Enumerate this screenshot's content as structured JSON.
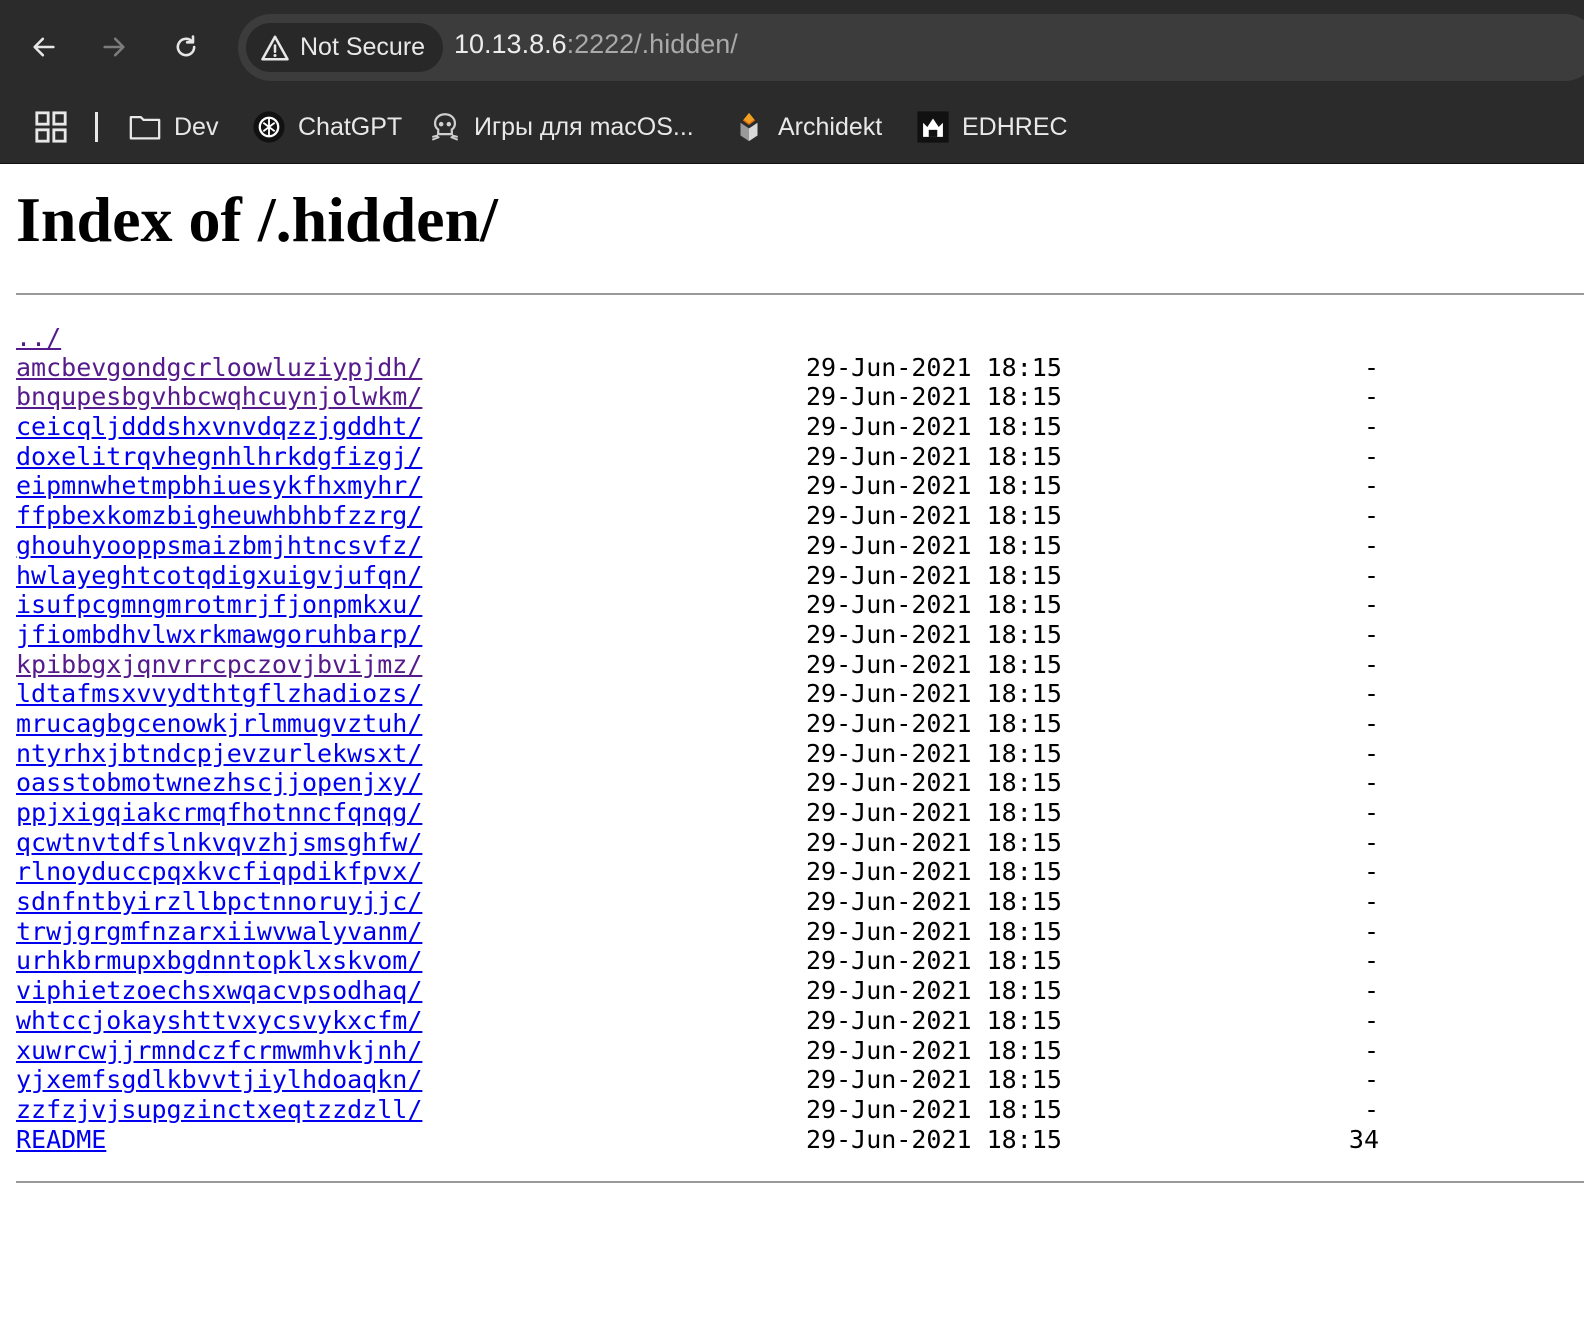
{
  "browser": {
    "security_label": "Not Secure",
    "url_host": "10.13.8.6",
    "url_rest": ":2222/.hidden/",
    "bookmarks": [
      {
        "label": "Dev",
        "icon": "folder-icon"
      },
      {
        "label": "ChatGPT",
        "icon": "chatgpt-icon"
      },
      {
        "label": "Игры для macOS...",
        "icon": "skull-icon"
      },
      {
        "label": "Archidekt",
        "icon": "archidekt-icon"
      },
      {
        "label": "EDHREC",
        "icon": "edhrec-icon"
      }
    ]
  },
  "page": {
    "title": "Index of /.hidden/",
    "parent_link": "../",
    "entries": [
      {
        "name": "amcbevgondgcrloowluziypjdh/",
        "date": "29-Jun-2021 18:15",
        "size": "-",
        "visited": true
      },
      {
        "name": "bnqupesbgvhbcwqhcuynjolwkm/",
        "date": "29-Jun-2021 18:15",
        "size": "-",
        "visited": true
      },
      {
        "name": "ceicqljdddshxvnvdqzzjgddht/",
        "date": "29-Jun-2021 18:15",
        "size": "-",
        "visited": false
      },
      {
        "name": "doxelitrqvhegnhlhrkdgfizgj/",
        "date": "29-Jun-2021 18:15",
        "size": "-",
        "visited": false
      },
      {
        "name": "eipmnwhetmpbhiuesykfhxmyhr/",
        "date": "29-Jun-2021 18:15",
        "size": "-",
        "visited": false
      },
      {
        "name": "ffpbexkomzbigheuwhbhbfzzrg/",
        "date": "29-Jun-2021 18:15",
        "size": "-",
        "visited": false
      },
      {
        "name": "ghouhyooppsmaizbmjhtncsvfz/",
        "date": "29-Jun-2021 18:15",
        "size": "-",
        "visited": false
      },
      {
        "name": "hwlayeghtcotqdigxuigvjufqn/",
        "date": "29-Jun-2021 18:15",
        "size": "-",
        "visited": false
      },
      {
        "name": "isufpcgmngmrotmrjfjonpmkxu/",
        "date": "29-Jun-2021 18:15",
        "size": "-",
        "visited": false
      },
      {
        "name": "jfiombdhvlwxrkmawgoruhbarp/",
        "date": "29-Jun-2021 18:15",
        "size": "-",
        "visited": false
      },
      {
        "name": "kpibbgxjqnvrrcpczovjbvijmz/",
        "date": "29-Jun-2021 18:15",
        "size": "-",
        "visited": true
      },
      {
        "name": "ldtafmsxvvydthtgflzhadiozs/",
        "date": "29-Jun-2021 18:15",
        "size": "-",
        "visited": false
      },
      {
        "name": "mrucagbgcenowkjrlmmugvztuh/",
        "date": "29-Jun-2021 18:15",
        "size": "-",
        "visited": false
      },
      {
        "name": "ntyrhxjbtndcpjevzurlekwsxt/",
        "date": "29-Jun-2021 18:15",
        "size": "-",
        "visited": false
      },
      {
        "name": "oasstobmotwnezhscjjopenjxy/",
        "date": "29-Jun-2021 18:15",
        "size": "-",
        "visited": false
      },
      {
        "name": "ppjxigqiakcrmqfhotnncfqnqg/",
        "date": "29-Jun-2021 18:15",
        "size": "-",
        "visited": false
      },
      {
        "name": "qcwtnvtdfslnkvqvzhjsmsghfw/",
        "date": "29-Jun-2021 18:15",
        "size": "-",
        "visited": false
      },
      {
        "name": "rlnoyduccpqxkvcfiqpdikfpvx/",
        "date": "29-Jun-2021 18:15",
        "size": "-",
        "visited": false
      },
      {
        "name": "sdnfntbyirzllbpctnnoruyjjc/",
        "date": "29-Jun-2021 18:15",
        "size": "-",
        "visited": false
      },
      {
        "name": "trwjgrgmfnzarxiiwvwalyvanm/",
        "date": "29-Jun-2021 18:15",
        "size": "-",
        "visited": false
      },
      {
        "name": "urhkbrmupxbgdnntopklxskvom/",
        "date": "29-Jun-2021 18:15",
        "size": "-",
        "visited": false
      },
      {
        "name": "viphietzoechsxwqacvpsodhaq/",
        "date": "29-Jun-2021 18:15",
        "size": "-",
        "visited": false
      },
      {
        "name": "whtccjokayshttvxycsvykxcfm/",
        "date": "29-Jun-2021 18:15",
        "size": "-",
        "visited": false
      },
      {
        "name": "xuwrcwjjrmndczfcrmwmhvkjnh/",
        "date": "29-Jun-2021 18:15",
        "size": "-",
        "visited": false
      },
      {
        "name": "yjxemfsgdlkbvvtjiylhdoaqkn/",
        "date": "29-Jun-2021 18:15",
        "size": "-",
        "visited": false
      },
      {
        "name": "zzfzjvjsupgzinctxeqtzzdzll/",
        "date": "29-Jun-2021 18:15",
        "size": "-",
        "visited": false
      },
      {
        "name": "README",
        "date": "29-Jun-2021 18:15",
        "size": "34",
        "visited": false
      }
    ]
  },
  "colors": {
    "link": "#0000ee",
    "link_visited": "#551a8b",
    "chrome_bg": "#2b2b2b"
  }
}
